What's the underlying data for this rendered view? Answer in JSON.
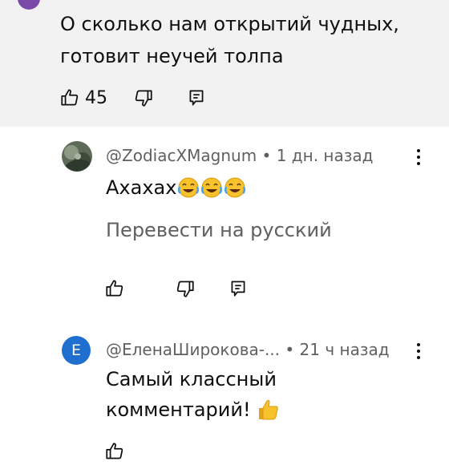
{
  "parent_comment": {
    "text_line1": "О сколько нам открытий чудных,",
    "text_line2": "готовит неучей толпа",
    "like_count": "45"
  },
  "replies": [
    {
      "author": "@ZodiacXMagnum",
      "separator": "•",
      "time": "1 дн. назад",
      "text": "Ахахах",
      "emoji_count": 3,
      "translate_label": "Перевести на русский"
    },
    {
      "author": "@ЕленаШирокова-...",
      "separator": "•",
      "time": "21 ч назад",
      "avatar_letter": "Е",
      "avatar_color": "#1e6fd0",
      "text_line1": "Самый классный",
      "text_line2": "комментарий!"
    }
  ],
  "icons": {
    "like": "thumbs-up-icon",
    "dislike": "thumbs-down-icon",
    "reply": "reply-icon",
    "more": "more-vert-icon",
    "laugh_emoji": "face-with-tears-of-joy-icon",
    "thumbs_emoji": "thumbs-up-emoji-icon"
  }
}
